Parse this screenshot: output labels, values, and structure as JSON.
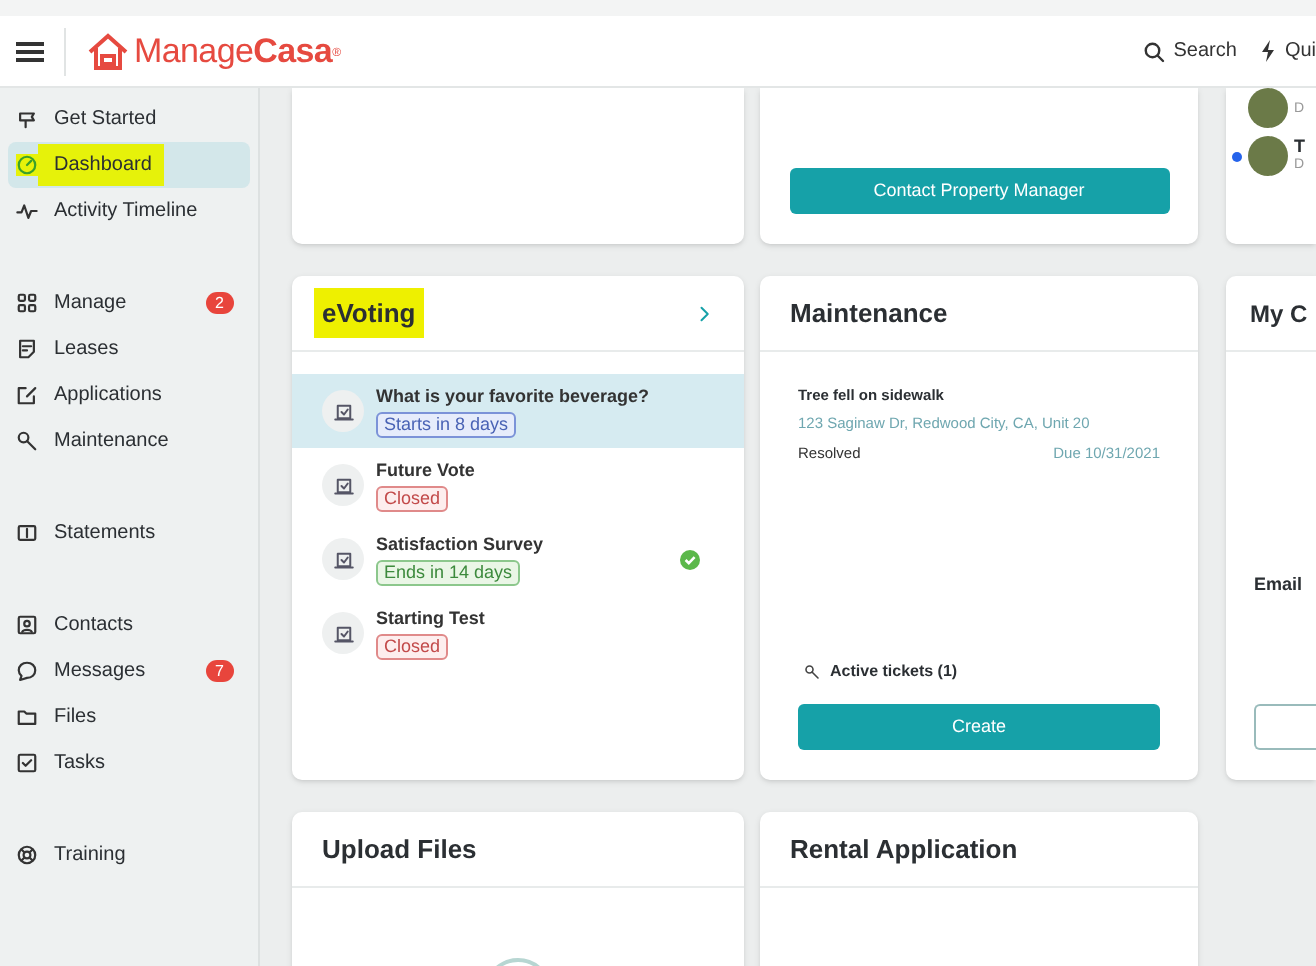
{
  "header": {
    "logo": {
      "plain": "Manage",
      "bold": "Casa",
      "mark": "®"
    },
    "search": "Search",
    "quick": "Qui"
  },
  "sidebar": {
    "groups": [
      [
        {
          "label": "Get Started",
          "selected": false,
          "highlighted": false
        },
        {
          "label": "Dashboard",
          "selected": true,
          "highlighted": true
        },
        {
          "label": "Activity Timeline",
          "selected": false,
          "highlighted": false
        }
      ],
      [
        {
          "label": "Manage",
          "selected": false,
          "highlighted": false,
          "badge": "2"
        },
        {
          "label": "Leases",
          "selected": false,
          "highlighted": false
        },
        {
          "label": "Applications",
          "selected": false,
          "highlighted": false
        },
        {
          "label": "Maintenance",
          "selected": false,
          "highlighted": false
        }
      ],
      [
        {
          "label": "Statements",
          "selected": false,
          "highlighted": false
        }
      ],
      [
        {
          "label": "Contacts",
          "selected": false,
          "highlighted": false
        },
        {
          "label": "Messages",
          "selected": false,
          "highlighted": false,
          "badge": "7"
        },
        {
          "label": "Files",
          "selected": false,
          "highlighted": false
        },
        {
          "label": "Tasks",
          "selected": false,
          "highlighted": false
        }
      ],
      [
        {
          "label": "Training",
          "selected": false,
          "highlighted": false
        }
      ]
    ]
  },
  "top_row": {
    "contact_button": "Contact Property Manager",
    "people": [
      {
        "initial": "D",
        "unread": false
      },
      {
        "name": "T",
        "initial": "D",
        "unread": true
      }
    ]
  },
  "evoting": {
    "title": "eVoting",
    "highlighted": true,
    "items": [
      {
        "title": "What is your favorite beverage?",
        "status": "Starts in 8 days",
        "kind": "upcoming",
        "selected": true,
        "voted": false
      },
      {
        "title": "Future Vote",
        "status": "Closed",
        "kind": "closed",
        "selected": false,
        "voted": false
      },
      {
        "title": "Satisfaction Survey",
        "status": "Ends in 14 days",
        "kind": "open",
        "selected": false,
        "voted": true
      },
      {
        "title": "Starting Test",
        "status": "Closed",
        "kind": "closed",
        "selected": false,
        "voted": false
      }
    ]
  },
  "maintenance": {
    "title": "Maintenance",
    "ticket": {
      "title": "Tree fell on sidewalk",
      "address": "123 Saginaw Dr, Redwood City, CA, Unit 20",
      "status": "Resolved",
      "due": "Due 10/31/2021"
    },
    "active": "Active tickets (1)",
    "button": "Create"
  },
  "contact_card": {
    "title": "My C",
    "field_label": "Email"
  },
  "bottom_row": [
    "Upload Files",
    "Rental Application"
  ]
}
